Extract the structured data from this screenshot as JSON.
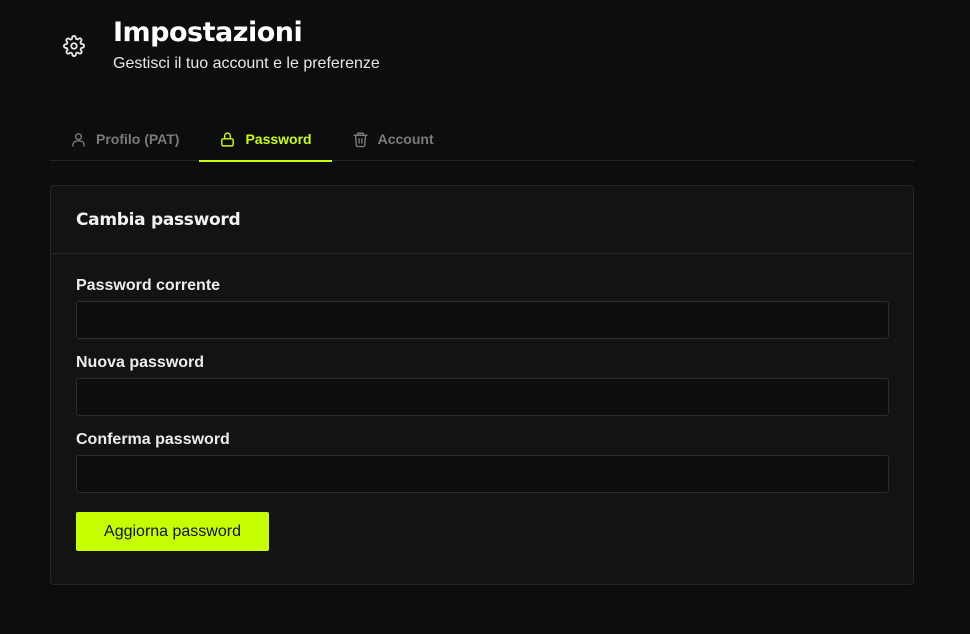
{
  "header": {
    "icon": "gear-icon",
    "title": "Impostazioni",
    "subtitle": "Gestisci il tuo account e le preferenze"
  },
  "tabs": [
    {
      "label": "Profilo (PAT)",
      "icon": "user-icon",
      "active": false
    },
    {
      "label": "Password",
      "icon": "lock-icon",
      "active": true
    },
    {
      "label": "Account",
      "icon": "trash-icon",
      "active": false
    }
  ],
  "card": {
    "title": "Cambia password",
    "fields": [
      {
        "label": "Password corrente",
        "value": "",
        "placeholder": ""
      },
      {
        "label": "Nuova password",
        "value": "",
        "placeholder": ""
      },
      {
        "label": "Conferma password",
        "value": "",
        "placeholder": ""
      }
    ],
    "submit_label": "Aggiorna password"
  },
  "colors": {
    "accent": "#c8ff00",
    "background": "#0d0d0d",
    "card": "#131313"
  }
}
